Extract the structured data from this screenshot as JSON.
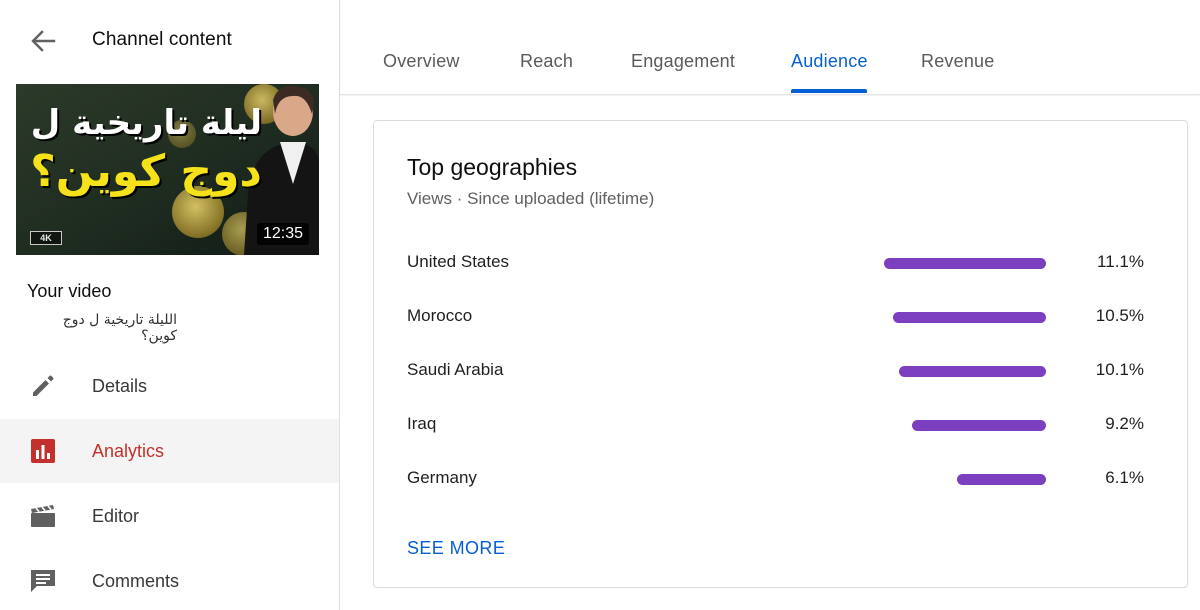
{
  "sidebar": {
    "title": "Channel content",
    "back_icon": "arrow-left-icon",
    "thumbnail": {
      "text_line1": "ليلة تاريخية ل",
      "text_line2": "دوج كوين؟",
      "duration": "12:35",
      "quality_badge": "4K"
    },
    "your_video_label": "Your video",
    "video_title": "الليلة تاريخية ل دوج كوين؟",
    "nav": [
      {
        "id": "details",
        "label": "Details",
        "icon": "pencil-icon",
        "active": false
      },
      {
        "id": "analytics",
        "label": "Analytics",
        "icon": "analytics-icon",
        "active": true
      },
      {
        "id": "editor",
        "label": "Editor",
        "icon": "clapperboard-icon",
        "active": false
      },
      {
        "id": "comments",
        "label": "Comments",
        "icon": "comment-icon",
        "active": false
      }
    ]
  },
  "tabs": [
    {
      "label": "Overview",
      "active": false
    },
    {
      "label": "Reach",
      "active": false
    },
    {
      "label": "Engagement",
      "active": false
    },
    {
      "label": "Audience",
      "active": true
    },
    {
      "label": "Revenue",
      "active": false
    }
  ],
  "card": {
    "title": "Top geographies",
    "subtitle": "Views · Since uploaded (lifetime)",
    "rows": [
      {
        "country": "United States",
        "value": "11.1%",
        "share": 11.1
      },
      {
        "country": "Morocco",
        "value": "10.5%",
        "share": 10.5
      },
      {
        "country": "Saudi Arabia",
        "value": "10.1%",
        "share": 10.1
      },
      {
        "country": "Iraq",
        "value": "9.2%",
        "share": 9.2
      },
      {
        "country": "Germany",
        "value": "6.1%",
        "share": 6.1
      }
    ],
    "see_more": "SEE MORE"
  },
  "colors": {
    "accent_blue": "#065fd4",
    "active_red": "#c4302b",
    "bar_purple": "#7b3fbf"
  }
}
